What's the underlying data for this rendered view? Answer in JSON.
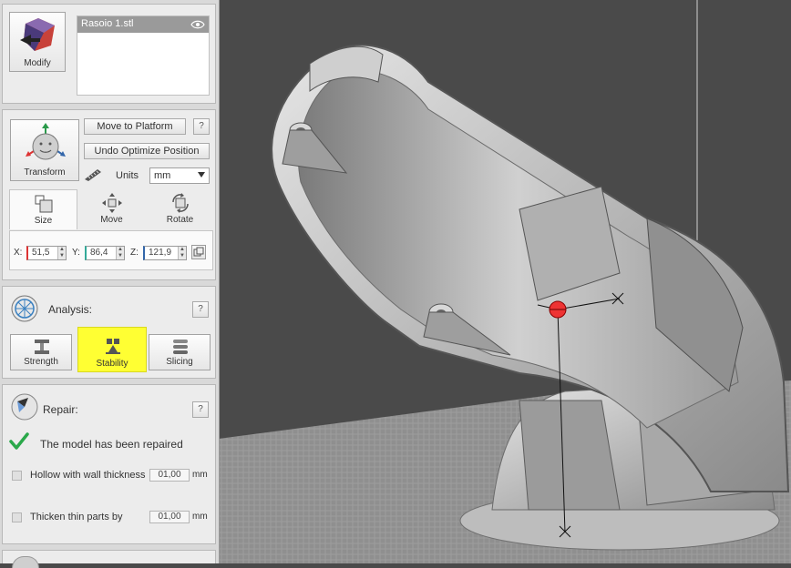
{
  "modify": {
    "button_label": "Modify",
    "file_name": "Rasoio 1.stl",
    "visibility_icon": "eye-icon"
  },
  "transform": {
    "button_label": "Transform",
    "move_to_platform": "Move to Platform",
    "undo_optimize": "Undo Optimize Position",
    "help": "?",
    "units_label": "Units",
    "units_value": "mm",
    "tabs": [
      {
        "label": "Size",
        "icon": "size-icon"
      },
      {
        "label": "Move",
        "icon": "move-icon"
      },
      {
        "label": "Rotate",
        "icon": "rotate-icon"
      }
    ],
    "x_label": "X:",
    "x_value": "51,5",
    "y_label": "Y:",
    "y_value": "86,4",
    "z_label": "Z:",
    "z_value": "121,9"
  },
  "analysis": {
    "title": "Analysis:",
    "help": "?",
    "buttons": [
      {
        "label": "Strength",
        "icon": "strength-icon"
      },
      {
        "label": "Stability",
        "icon": "stability-icon",
        "highlighted": true,
        "highlight_color": "#ffff33"
      },
      {
        "label": "Slicing",
        "icon": "slicing-icon"
      }
    ]
  },
  "repair": {
    "title": "Repair:",
    "help": "?",
    "status": "The model has been repaired",
    "status_color": "#2aa84a",
    "hollow_label": "Hollow with wall thickness",
    "hollow_value": "01,00",
    "hollow_unit": "mm",
    "thicken_label": "Thicken thin parts by",
    "thicken_value": "01,00",
    "thicken_unit": "mm"
  },
  "colors": {
    "viewport_bg": "#4a4a4a",
    "floor": "#8e8e8e",
    "model": "#c8c8c8",
    "axis_x": "#d33",
    "axis_y": "#3a9",
    "axis_z": "#36a"
  }
}
